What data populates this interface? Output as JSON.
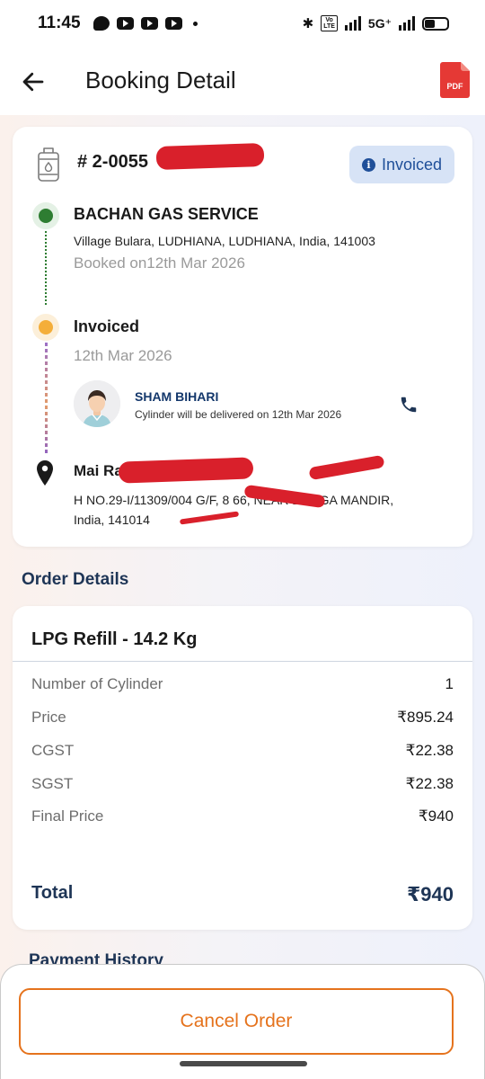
{
  "status_bar": {
    "time": "11:45",
    "network": "5G⁺",
    "volte": "Vo\nLTE"
  },
  "header": {
    "title": "Booking Detail",
    "pdf_label": "PDF"
  },
  "booking": {
    "booking_no_prefix": "# 2-0055",
    "status_chip": "Invoiced",
    "agency_name": "BACHAN GAS SERVICE",
    "agency_address": "Village Bulara, LUDHIANA, LUDHIANA, India, 141003",
    "booked_on": "Booked on12th Mar 2026",
    "invoiced_title": "Invoiced",
    "invoiced_date": "12th Mar 2026",
    "driver_name": "SHAM BIHARI",
    "delivery_note": "Cylinder will be delivered on 12th Mar 2026",
    "consumer_name": "Mai Raj                       S/o Hari R",
    "consumer_address": "H NO.29-I/11309/004 G/F, 8              66, NEAR DURGA MANDIR, India, 141014"
  },
  "order": {
    "section_title": "Order Details",
    "product": "LPG Refill - 14.2 Kg",
    "rows": [
      {
        "label": "Number of Cylinder",
        "value": "1"
      },
      {
        "label": "Price",
        "value": "₹895.24"
      },
      {
        "label": "CGST",
        "value": "₹22.38"
      },
      {
        "label": "SGST",
        "value": "₹22.38"
      },
      {
        "label": "Final Price",
        "value": "₹940"
      }
    ],
    "total_label": "Total",
    "total_value": "₹940"
  },
  "payment_history_title": "Payment History",
  "actions": {
    "cancel_label": "Cancel Order"
  },
  "colors": {
    "accent_orange": "#e5731d",
    "navy": "#1e3556",
    "invoiced_chip_bg": "#d7e3f6",
    "invoiced_chip_text": "#1f4f99",
    "booked_green": "#2e7d32",
    "invoiced_orange": "#f4ae3a",
    "redaction_red": "#d9202b"
  }
}
